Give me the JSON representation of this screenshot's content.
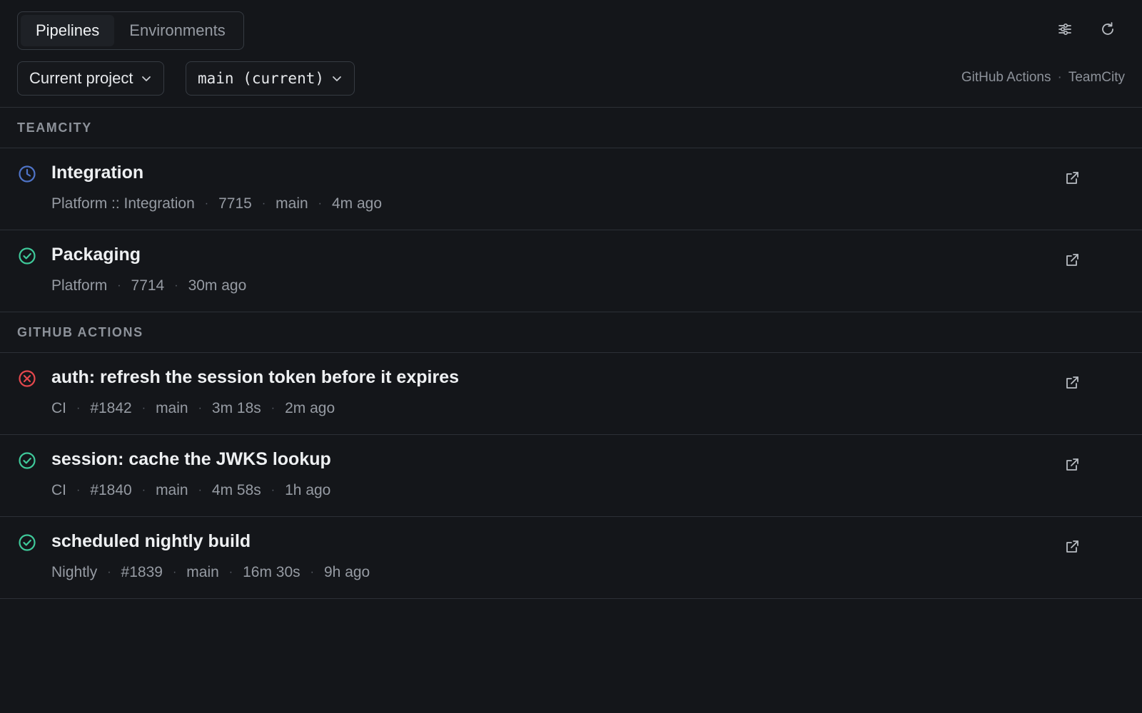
{
  "tabs": [
    {
      "label": "Pipelines",
      "active": true
    },
    {
      "label": "Environments",
      "active": false
    }
  ],
  "filters": {
    "scope": "Current project",
    "branch": "main (current)"
  },
  "toolbar": {
    "filter_icon": "sliders-icon",
    "refresh_icon": "refresh-icon"
  },
  "providers": [
    "GitHub Actions",
    "TeamCity"
  ],
  "groups": [
    {
      "header": "TEAMCITY",
      "runs": [
        {
          "status": "running",
          "title": "Integration",
          "meta": [
            "Platform :: Integration",
            "7715",
            "main",
            "4m ago"
          ]
        },
        {
          "status": "success",
          "title": "Packaging",
          "meta": [
            "Platform",
            "7714",
            "30m ago"
          ]
        }
      ]
    },
    {
      "header": "GITHUB ACTIONS",
      "runs": [
        {
          "status": "failed",
          "title": "auth: refresh the session token before it expires",
          "meta": [
            "CI",
            "#1842",
            "main",
            "3m 18s",
            "2m ago"
          ]
        },
        {
          "status": "success",
          "title": "session: cache the JWKS lookup",
          "meta": [
            "CI",
            "#1840",
            "main",
            "4m 58s",
            "1h ago"
          ]
        },
        {
          "status": "success",
          "title": "scheduled nightly build",
          "meta": [
            "Nightly",
            "#1839",
            "main",
            "16m 30s",
            "9h ago"
          ]
        }
      ]
    }
  ],
  "colors": {
    "running": "#4f74c8",
    "success": "#3fc99a",
    "failed": "#e5484d"
  }
}
